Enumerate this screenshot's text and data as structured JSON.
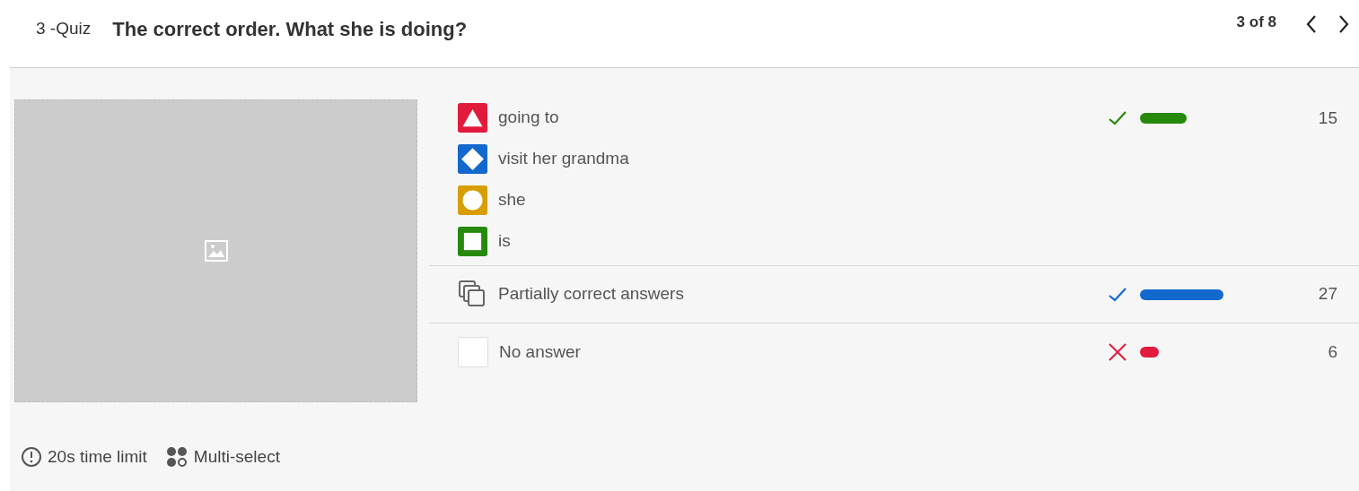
{
  "header": {
    "quiz_label": "3 -Quiz",
    "question": "The correct order. What she is doing?",
    "position": "3 of 8"
  },
  "groups": [
    {
      "kind": "options",
      "options": [
        {
          "kind": "triangle",
          "color": "#e21b3c",
          "text": "going to"
        },
        {
          "kind": "diamond",
          "color": "#1368ce",
          "text": "visit her grandma"
        },
        {
          "kind": "circle",
          "color": "#d89e00",
          "text": "she"
        },
        {
          "kind": "square",
          "color": "#26890c",
          "text": "is"
        }
      ],
      "result": {
        "kind": "correct",
        "color": "#26890c",
        "count": "15"
      }
    },
    {
      "kind": "partial",
      "text": "Partially correct answers",
      "result": {
        "kind": "correct",
        "color": "#1368ce",
        "count": "27"
      }
    },
    {
      "kind": "none",
      "text": "No answer",
      "result": {
        "kind": "wrong",
        "color": "#e21b3c",
        "count": "6"
      }
    }
  ],
  "footer": [
    {
      "kind": "time",
      "text": "20s time limit"
    },
    {
      "kind": "multi",
      "text": "Multi-select"
    }
  ]
}
